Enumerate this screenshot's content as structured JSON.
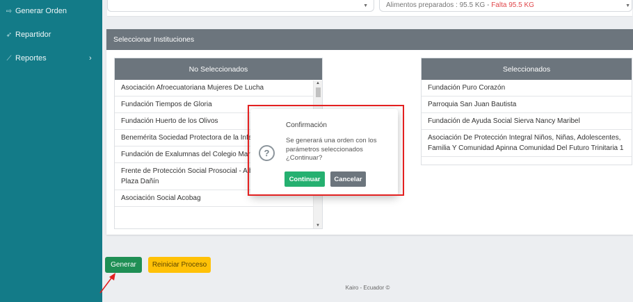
{
  "sidebar": {
    "items": [
      {
        "label": "Generar Orden",
        "icon": "arrow-icon"
      },
      {
        "label": "Repartidor",
        "icon": "send-icon"
      },
      {
        "label": "Reportes",
        "icon": "chart-icon"
      }
    ]
  },
  "top": {
    "food_text": "Alimentos preparados : 95.5 KG - ",
    "falta_text": "Falta 95.5 KG"
  },
  "institutions": {
    "header": "Seleccionar Instituciones",
    "not_selected": {
      "title": "No Seleccionados",
      "items": [
        "Asociación Afroecuatoriana Mujeres De Lucha",
        "Fundación Tiempos de Gloria",
        "Fundación Huerto de los Olivos",
        "Benemérita Sociedad Protectora de la Infancia Chambers",
        "Fundación de Exalumnas del Colegio María Dominga Bocca",
        "Frente de Protección Social Prosocial - Albergue Carlos Luis Plaza Dañín",
        "Asociación Social Acobag"
      ]
    },
    "selected": {
      "title": "Seleccionados",
      "items": [
        "Fundación Puro Corazón",
        "Parroquia San Juan Bautista",
        "Fundación de Ayuda Social Sierva Nancy Maribel",
        "Asociación De Protección Integral Niños, Niñas, Adolescentes, Familia Y Comunidad Apinna Comunidad Del Futuro Trinitaria 1"
      ]
    }
  },
  "dialog": {
    "title": "Confirmación",
    "message": "Se generará una orden con los parámetros seleccionados ¿Continuar?",
    "confirm_label": "Continuar",
    "cancel_label": "Cancelar",
    "icon": "question-icon"
  },
  "actions": {
    "generate_label": "Generar",
    "reset_label": "Reiniciar Proceso"
  },
  "footer": "Kairo - Ecuador ©",
  "colors": {
    "sidebar": "#137b88",
    "header_gray": "#6c757d",
    "confirm_green": "#25b070",
    "generate_green": "#1f8f55",
    "reset_yellow": "#ffc107",
    "highlight_red": "#e32020",
    "falta_red": "#e0464a"
  }
}
